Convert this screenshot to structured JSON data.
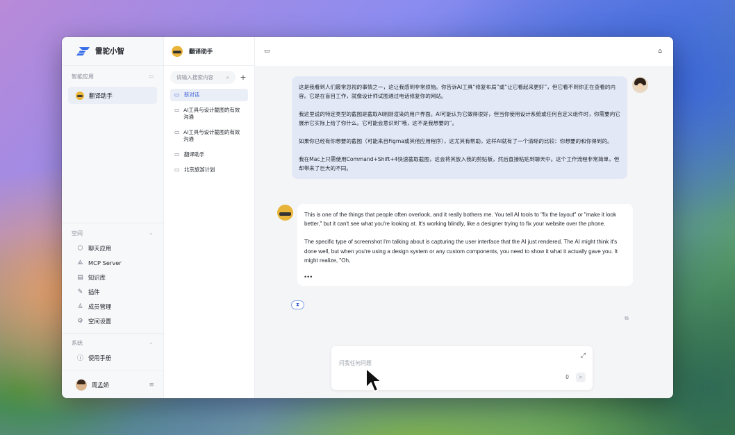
{
  "sidebar": {
    "brand": "雷驼小智",
    "apps_section": "智能应用",
    "app_item": "翻译助手",
    "space_section": "空间",
    "nav": [
      {
        "icon": "chat-app-icon",
        "glyph": "⬡",
        "label": "聊天应用"
      },
      {
        "icon": "mcp-icon",
        "glyph": "⟁",
        "label": "MCP Server"
      },
      {
        "icon": "knowledge-icon",
        "glyph": "▤",
        "label": "知识库"
      },
      {
        "icon": "plugin-icon",
        "glyph": "✎",
        "label": "插件"
      },
      {
        "icon": "members-icon",
        "glyph": "♙",
        "label": "成员管理"
      },
      {
        "icon": "settings-icon",
        "glyph": "⚙",
        "label": "空间设置"
      }
    ],
    "system_section": "系统",
    "manual": "使用手册",
    "user_name": "周孟娇"
  },
  "conversations": {
    "title": "翻译助手",
    "search_placeholder": "请输入搜索内容",
    "items": [
      {
        "label": "新对话",
        "active": true
      },
      {
        "label": "AI工具与设计截图的有效沟通",
        "active": false
      },
      {
        "label": "AI工具与设计截图的有效沟通",
        "active": false
      },
      {
        "label": "翻译助手",
        "active": false
      },
      {
        "label": "北京旅游计划",
        "active": false
      }
    ]
  },
  "chat": {
    "user_message": [
      "这是我看到人们最常忽视的事情之一，这让我感到非常烦恼。你告诉AI工具“修复布局”或“让它看起来更好”，但它看不到你正在查看的内容。它是在盲目工作，就像设计师试图通过电话修复你的网站。",
      "我这里说的特定类型的截图是截取AI刚刚渲染的用户界面。AI可能认为它做得很好，但当你使用设计系统或任何自定义组件时，你需要向它展示它实际上给了你什么。它可能会意识到“哦，这不是我想要的”。",
      "如果你已经有你想要的截图（可能来自Figma或其他应用程序），这尤其有帮助，这样AI就有了一个清晰的比较：你想要的和你得到的。",
      "我在Mac上只需使用Command+Shift+4快速截取截图，这会将其放入我的剪贴板，然后直接粘贴到聊天中。这个工作流程非常简单，但却带来了巨大的不同。"
    ],
    "bot_message": [
      "This is one of the things that people often overlook, and it really bothers me. You tell AI tools to \"fix the layout\" or \"make it look better,\" but it can't see what you're looking at. It's working blindly, like a designer trying to fix your website over the phone.",
      "The specific type of screenshot I'm talking about is capturing the user interface that the AI just rendered. The AI might think it's done well, but when you're using a design system or any custom components, you need to show it what it actually gave you. It might realize, \"Oh,"
    ],
    "bot_loading": "•••",
    "composer_placeholder": "问我任何问题",
    "char_count": "0"
  },
  "colors": {
    "accent": "#3a5fd8",
    "user_bubble": "#e3e8f7",
    "sidebar_bg": "#f7f8fa"
  }
}
